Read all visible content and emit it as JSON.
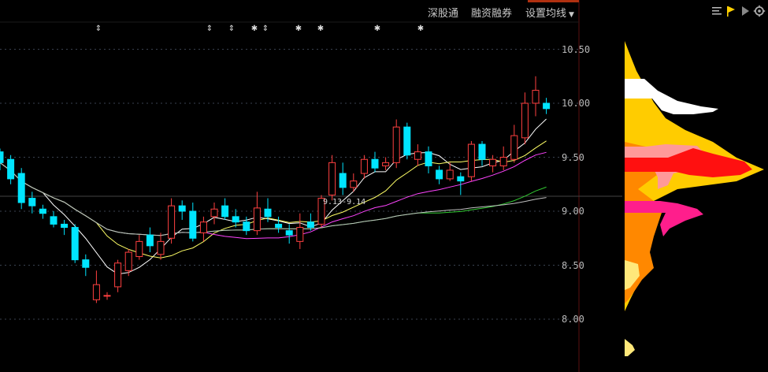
{
  "toolbar": {
    "shenzhen_connect": "深股通",
    "margin_trading": "融资融券",
    "set_ma": "设置均线"
  },
  "price_axis": [
    "10.50",
    "10.00",
    "9.50",
    "9.00",
    "8.50",
    "8.00"
  ],
  "annotation_label": "9.13-9.14",
  "side_icons": [
    "list-icon",
    "flag-icon",
    "play-icon",
    "settings-icon"
  ],
  "chart_data": {
    "type": "candlestick",
    "title": "",
    "ylim": [
      7.6,
      10.9
    ],
    "y_ticks": [
      8.0,
      8.5,
      9.0,
      9.5,
      10.0,
      10.5
    ],
    "colors": {
      "up": "#ff4040",
      "down": "#00e5ff",
      "ma5": "#ffffff",
      "ma10": "#ffff66",
      "ma20": "#ff44ff",
      "ma60": "#33cc33",
      "ma120": "#c0c0c0"
    },
    "candles": [
      [
        9.55,
        9.45,
        9.58,
        9.38
      ],
      [
        9.48,
        9.3,
        9.52,
        9.25
      ],
      [
        9.35,
        9.08,
        9.4,
        9.02
      ],
      [
        9.12,
        9.05,
        9.18,
        8.98
      ],
      [
        9.02,
        8.98,
        9.06,
        8.93
      ],
      [
        8.95,
        8.88,
        9.0,
        8.85
      ],
      [
        8.88,
        8.85,
        8.92,
        8.78
      ],
      [
        8.85,
        8.55,
        8.88,
        8.52
      ],
      [
        8.55,
        8.48,
        8.6,
        8.4
      ],
      [
        8.18,
        8.32,
        8.45,
        8.15
      ],
      [
        8.22,
        8.22,
        8.25,
        8.18
      ],
      [
        8.3,
        8.52,
        8.55,
        8.25
      ],
      [
        8.45,
        8.62,
        8.65,
        8.4
      ],
      [
        8.58,
        8.72,
        8.78,
        8.55
      ],
      [
        8.78,
        8.68,
        8.85,
        8.62
      ],
      [
        8.6,
        8.72,
        8.8,
        8.55
      ],
      [
        8.75,
        9.05,
        9.12,
        8.7
      ],
      [
        9.05,
        9.0,
        9.1,
        8.92
      ],
      [
        9.0,
        8.75,
        9.08,
        8.72
      ],
      [
        8.8,
        8.9,
        8.95,
        8.72
      ],
      [
        8.95,
        9.02,
        9.08,
        8.88
      ],
      [
        9.05,
        8.95,
        9.12,
        8.92
      ],
      [
        8.95,
        8.9,
        9.02,
        8.85
      ],
      [
        8.9,
        8.82,
        8.95,
        8.78
      ],
      [
        8.82,
        9.03,
        9.18,
        8.78
      ],
      [
        9.02,
        8.95,
        9.12,
        8.9
      ],
      [
        8.88,
        8.85,
        8.95,
        8.8
      ],
      [
        8.82,
        8.78,
        8.88,
        8.7
      ],
      [
        8.72,
        8.85,
        8.98,
        8.65
      ],
      [
        8.9,
        8.85,
        8.98,
        8.82
      ],
      [
        8.88,
        9.12,
        9.15,
        8.85
      ],
      [
        9.15,
        9.45,
        9.52,
        9.1
      ],
      [
        9.35,
        9.22,
        9.45,
        9.15
      ],
      [
        9.22,
        9.28,
        9.35,
        9.18
      ],
      [
        9.35,
        9.48,
        9.52,
        9.3
      ],
      [
        9.48,
        9.4,
        9.55,
        9.36
      ],
      [
        9.42,
        9.45,
        9.5,
        9.38
      ],
      [
        9.45,
        9.78,
        9.85,
        9.4
      ],
      [
        9.78,
        9.52,
        9.82,
        9.48
      ],
      [
        9.48,
        9.55,
        9.62,
        9.42
      ],
      [
        9.55,
        9.42,
        9.6,
        9.35
      ],
      [
        9.38,
        9.3,
        9.42,
        9.25
      ],
      [
        9.3,
        9.38,
        9.45,
        9.28
      ],
      [
        9.32,
        9.28,
        9.36,
        9.15
      ],
      [
        9.32,
        9.62,
        9.65,
        9.28
      ],
      [
        9.62,
        9.48,
        9.65,
        9.42
      ],
      [
        9.42,
        9.48,
        9.52,
        9.36
      ],
      [
        9.42,
        9.5,
        9.6,
        9.38
      ],
      [
        9.48,
        9.7,
        9.8,
        9.45
      ],
      [
        9.68,
        10.0,
        10.1,
        9.62
      ],
      [
        10.0,
        10.12,
        10.25,
        9.88
      ],
      [
        10.0,
        9.95,
        10.05,
        9.9
      ]
    ]
  }
}
